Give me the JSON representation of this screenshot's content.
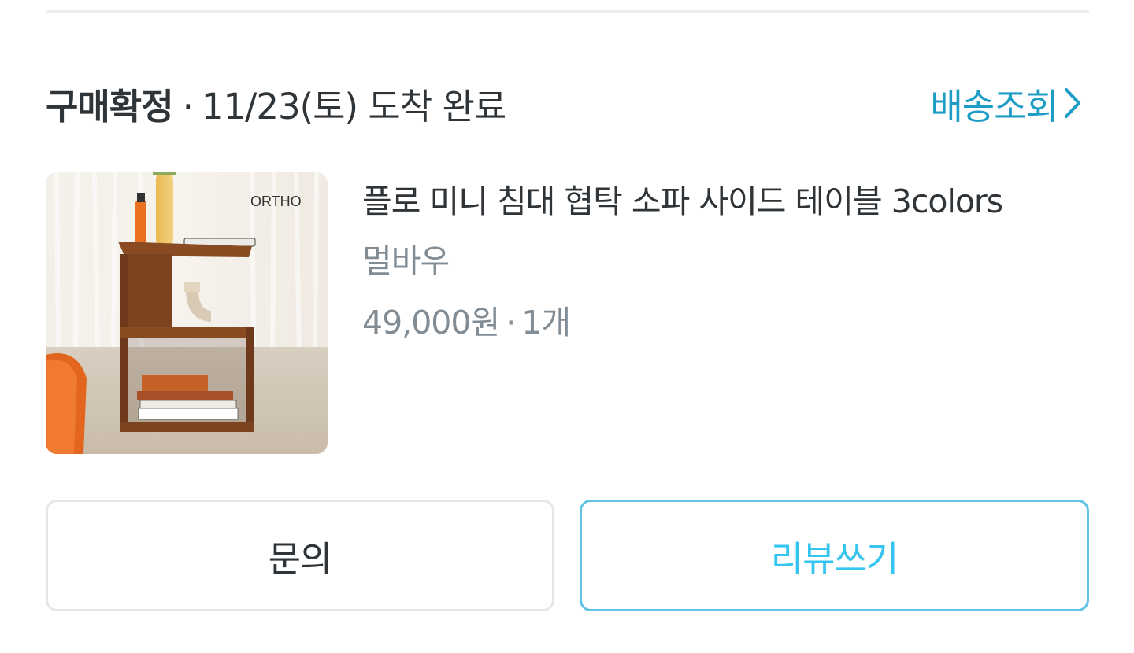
{
  "order": {
    "status_label": "구매확정",
    "status_separator": "·",
    "status_detail": "11/23(토) 도착 완료",
    "tracking_link_label": "배송조회"
  },
  "product": {
    "name": "플로 미니 침대 협탁 소파 사이드 테이블 3colors",
    "seller": "멀바우",
    "price": "49,000원",
    "price_separator": "·",
    "quantity": "1개",
    "image_brand_text": "ORTHO"
  },
  "actions": {
    "inquiry_label": "문의",
    "review_label": "리뷰쓰기"
  },
  "colors": {
    "accent_link": "#1d9dc6",
    "review_border": "#62c4e5",
    "review_text": "#35c5f0",
    "muted_text": "#828c94",
    "primary_text": "#2f3438"
  },
  "icons": {
    "tracking_chevron": "chevron-right-icon"
  }
}
